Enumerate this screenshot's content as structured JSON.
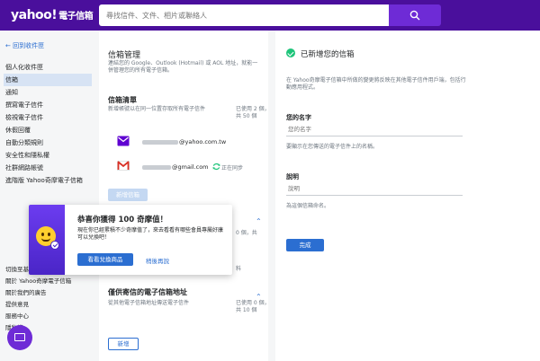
{
  "header": {
    "logo": "yahoo!",
    "logo_sub": "電子信箱",
    "search_placeholder": "尋找信件、文件、相片或聯絡人"
  },
  "sidebar": {
    "back": "← 回到收件匣",
    "items": [
      {
        "label": "個人化收件匣"
      },
      {
        "label": "信箱"
      },
      {
        "label": "通知"
      },
      {
        "label": "撰寫電子信件"
      },
      {
        "label": "檢視電子信件"
      },
      {
        "label": "休假回覆"
      },
      {
        "label": "自動分類規則"
      },
      {
        "label": "安全性和隱私權"
      },
      {
        "label": "社群網路帳號"
      },
      {
        "label": "進階版 Yahoo奇摩電子信箱"
      }
    ],
    "footer": [
      {
        "label": "切換至基本"
      },
      {
        "label": "關於 Yahoo奇摩電子信箱"
      },
      {
        "label": "關於我們的廣告"
      },
      {
        "label": "提供意見"
      },
      {
        "label": "服務中心"
      },
      {
        "label": "隱私權"
      }
    ]
  },
  "middle": {
    "title": "信箱管理",
    "desc": "連結您的 Google、Outlook (Hotmail) 或 AOL 地址，就能一併管理您的所有電子信箱。",
    "list": {
      "title": "信箱清單",
      "desc": "新增帳號以在同一位置存取所有電子信件",
      "stat": "已使用 2 個，共 50 個",
      "accounts": [
        {
          "email": "@yahoo.com.tw",
          "status": ""
        },
        {
          "email": "@gmail.com",
          "status": "正在同步"
        }
      ],
      "add_button": "新增信箱"
    },
    "partial_stat": "0 個，共",
    "partial_stat2": "料",
    "send_only": {
      "title": "僅供寄信的電子信箱地址",
      "desc": "從其他電子信箱地址傳送電子信件",
      "stat": "已使用 0 個，共 10 個",
      "add_button": "新增"
    }
  },
  "right": {
    "title": "已新增您的信箱",
    "desc": "在 Yahoo奇摩電子信箱中所做的變更將反映在其他電子信件用戶端，包括行動應用程式。",
    "name_label": "您的名字",
    "name_placeholder": "您的名字",
    "name_hint": "要顯示在您傳送的電子信件上的名稱。",
    "desc_label": "說明",
    "desc_placeholder": "說明",
    "desc_hint": "為這個信箱命名。",
    "done": "完成"
  },
  "popup": {
    "title": "恭喜你獲得 100 奇摩值！",
    "text": "現在你已經累積不少奇摩值了，來去看看有哪些會員專屬好康可以兌換吧！",
    "primary": "看看兌換商品",
    "secondary": "稍後再說"
  },
  "colors": {
    "header_bg": "#4a0f9c",
    "accent": "#2b6ed1",
    "success": "#1ec47a"
  }
}
